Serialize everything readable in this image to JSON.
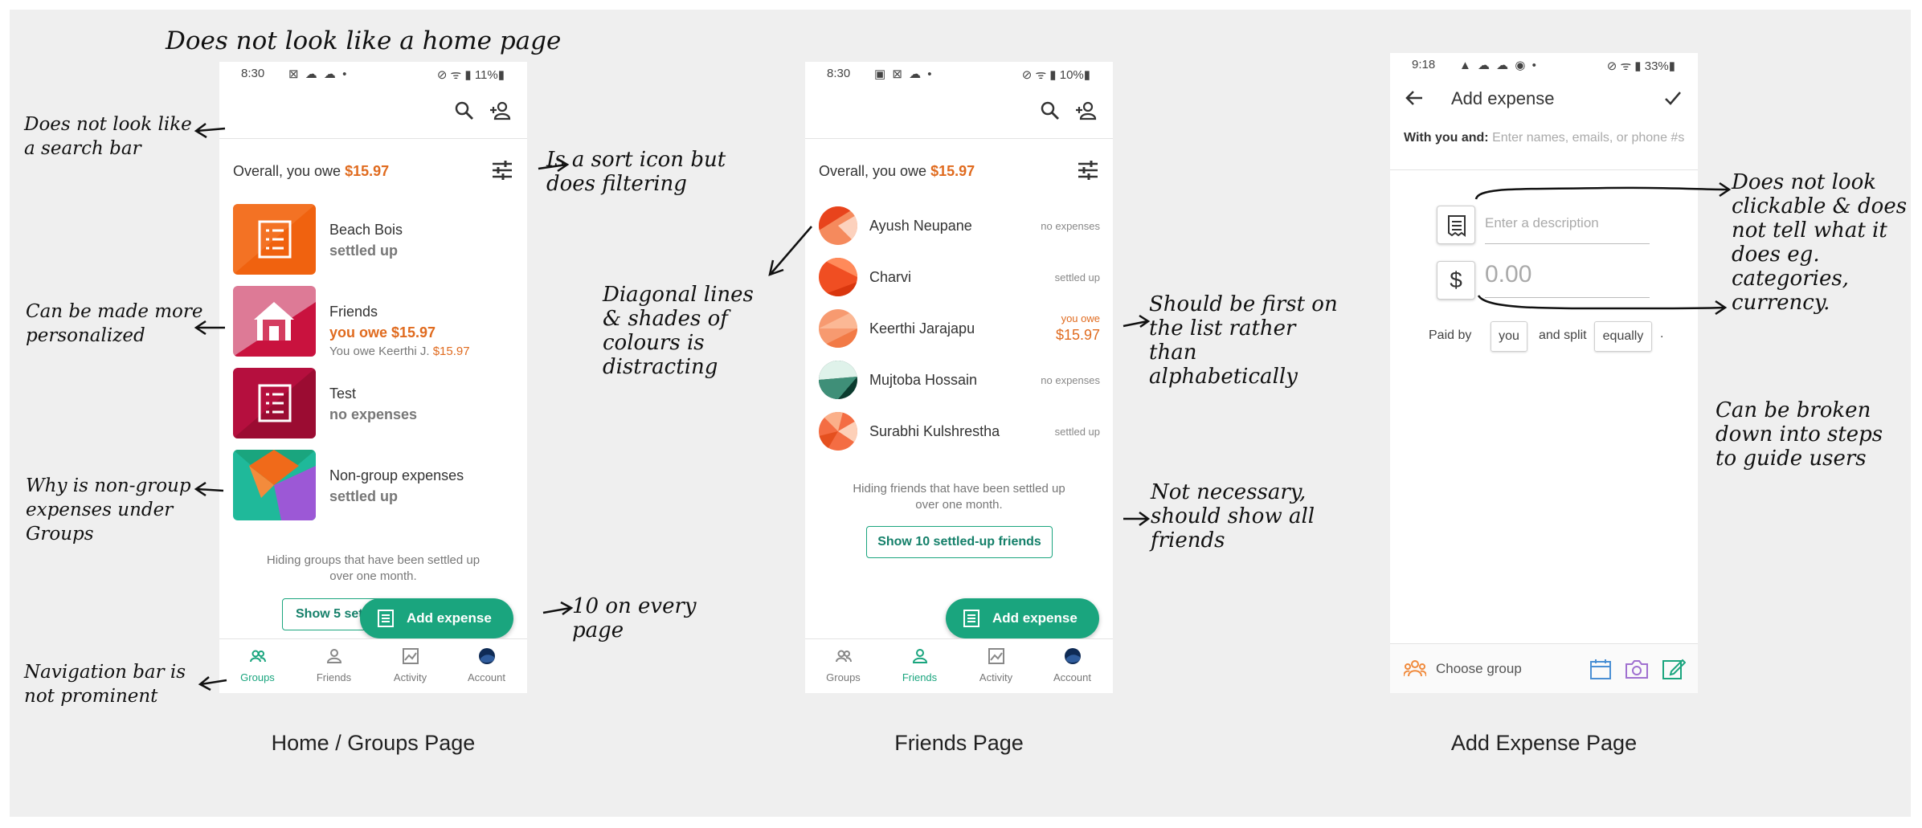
{
  "heading_note": "Does not look like a home page",
  "colors": {
    "accent": "#1aa57e",
    "owe": "#e06b1f",
    "background": "#efefef"
  },
  "groups_page": {
    "caption": "Home / Groups Page",
    "status": {
      "time": "8:30",
      "icons": "⊠ ☁ ☁ •",
      "battery": "⊘ ᯤ ▮ 11%▮"
    },
    "top_icons": [
      "search-icon",
      "add-person-icon"
    ],
    "overall_label": "Overall, you owe ",
    "overall_amount": "$15.97",
    "groups": [
      {
        "name": "Beach Bois",
        "status": "settled up",
        "icon": "receipt-icon"
      },
      {
        "name": "Friends",
        "status": "you owe $15.97",
        "sub_label": "You owe Keerthi J. ",
        "sub_amount": "$15.97",
        "icon": "house-icon"
      },
      {
        "name": "Test",
        "status": "no expenses",
        "icon": "receipt-icon"
      },
      {
        "name": "Non-group expenses",
        "status": "settled up",
        "icon": "non-group-icon"
      }
    ],
    "hide_note_line1": "Hiding groups that have been settled up",
    "hide_note_line2": "over one month.",
    "show_button": "Show 5 settl",
    "fab": "Add expense",
    "nav": [
      "Groups",
      "Friends",
      "Activity",
      "Account"
    ],
    "active_nav": "Groups"
  },
  "friends_page": {
    "caption": "Friends Page",
    "status": {
      "time": "8:30",
      "icons": "▣ ⊠ ☁ •",
      "battery": "⊘ ᯤ ▮ 10%▮"
    },
    "overall_label": "Overall, you owe ",
    "overall_amount": "$15.97",
    "friends": [
      {
        "name": "Ayush Neupane",
        "status": "no expenses"
      },
      {
        "name": "Charvi",
        "status": "settled up"
      },
      {
        "name": "Keerthi Jarajapu",
        "owe_label": "you owe",
        "owe_amount": "$15.97"
      },
      {
        "name": "Mujtoba Hossain",
        "status": "no expenses"
      },
      {
        "name": "Surabhi Kulshrestha",
        "status": "settled up"
      }
    ],
    "hide_note_line1": "Hiding friends that have been settled up",
    "hide_note_line2": "over one month.",
    "show_button": "Show 10 settled-up friends",
    "fab": "Add expense",
    "nav": [
      "Groups",
      "Friends",
      "Activity",
      "Account"
    ],
    "active_nav": "Friends"
  },
  "add_expense_page": {
    "caption": "Add Expense Page",
    "status": {
      "time": "9:18",
      "icons": "▲ ☁ ☁ ◉ •",
      "battery": "⊘ ᯤ ▮ 33%▮"
    },
    "title": "Add expense",
    "with_label": "With you and:",
    "with_placeholder": "Enter names, emails, or phone #s",
    "description_placeholder": "Enter a description",
    "currency_symbol": "$",
    "amount_placeholder": "0.00",
    "paid_by": "Paid by",
    "payer": "you",
    "and_split": "and split",
    "split": "equally",
    "period": ".",
    "choose_group": "Choose group"
  },
  "annotations": {
    "search_bar": "Does not look like a search bar",
    "sort_icon": "Is a sort icon but does filtering",
    "personalized": "Can be made more personalized",
    "non_group": "Why is non-group expenses under Groups",
    "nav_bar": "Navigation bar is not prominent",
    "diagonal": "Diagonal lines & shades of colours is distracting",
    "fab": "10 on every page",
    "first_list": "Should be first on the list rather than alphabetically",
    "not_necessary": "Not necessary, should show all friends",
    "not_clickable": "Does not look clickable & does not tell what it does eg. categories, currency.",
    "steps": "Can be broken down into steps to guide users"
  }
}
